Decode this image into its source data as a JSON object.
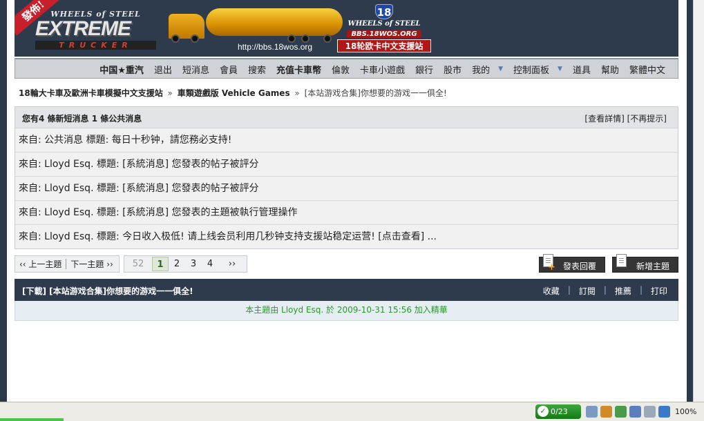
{
  "header": {
    "ribbon": "發佈!",
    "logo_top": "WHEELS of STEEL",
    "logo_main": "EXTREME",
    "logo_sub": "TRUCKER",
    "site_url": "http://bbs.18wos.org",
    "badge_num": "18",
    "badge_wos": "WHEELS of STEEL",
    "badge_url": "BBS.18WOS.ORG",
    "badge_cn": "18轮欧卡中文支援站"
  },
  "nav": {
    "items": [
      "中国★重汽",
      "退出",
      "短消息",
      "會員",
      "搜索",
      "充值卡車幣",
      "倫敦",
      "卡車小遊戲",
      "銀行",
      "股市",
      "我的",
      "控制面板",
      "道具",
      "幫助",
      "繁體中文"
    ]
  },
  "breadcrumb": {
    "site": "18輪大卡車及歐洲卡車模擬中文支援站",
    "sep": "»",
    "forum": "車類遊戲版 Vehicle Games",
    "current": "[本站游戏合集]你想要的游戏一一俱全!"
  },
  "messages": {
    "title": "您有4 條新短消息 1 條公共消息",
    "view_details": "[查看詳情]",
    "dismiss": "[不再提示]",
    "rows": [
      "來自: 公共消息     標題: 每日十秒钟，請您務必支持!",
      "來自: Lloyd Esq. 標題: [系統消息] 您發表的帖子被評分",
      "來自: Lloyd Esq. 標題: [系統消息] 您發表的帖子被評分",
      "來自: Lloyd Esq. 標題: [系統消息] 您發表的主題被執行管理操作",
      "來自: Lloyd Esq. 標題: 今日收入极低! 请上线会员利用几秒钟支持支援站稳定运营! [点击查看] ..."
    ]
  },
  "pager": {
    "prev": "‹‹ 上一主題",
    "next": "下一主題 ››",
    "first": "52",
    "pages": [
      "1",
      "2",
      "3",
      "4"
    ],
    "current": "1",
    "more": "››"
  },
  "buttons": {
    "reply": "發表回覆",
    "new_topic": "新增主題"
  },
  "thread": {
    "title": "[下載] [本站游戏合集]你想要的游戏一一俱全!",
    "actions": [
      "收藏",
      "訂閱",
      "推薦",
      "打印"
    ],
    "note": "本主題由 Lloyd Esq. 於 2009-10-31 15:56 加入精華"
  },
  "statusbar": {
    "progress": "0/23",
    "zoom": "100%"
  },
  "colors": {
    "header_bg": "#2e3b4c",
    "nav_bg": "#cfd2d7",
    "thread_bg": "#2e3b4d",
    "note_text": "#2a9a2a",
    "page_current": "#2a6a20"
  }
}
